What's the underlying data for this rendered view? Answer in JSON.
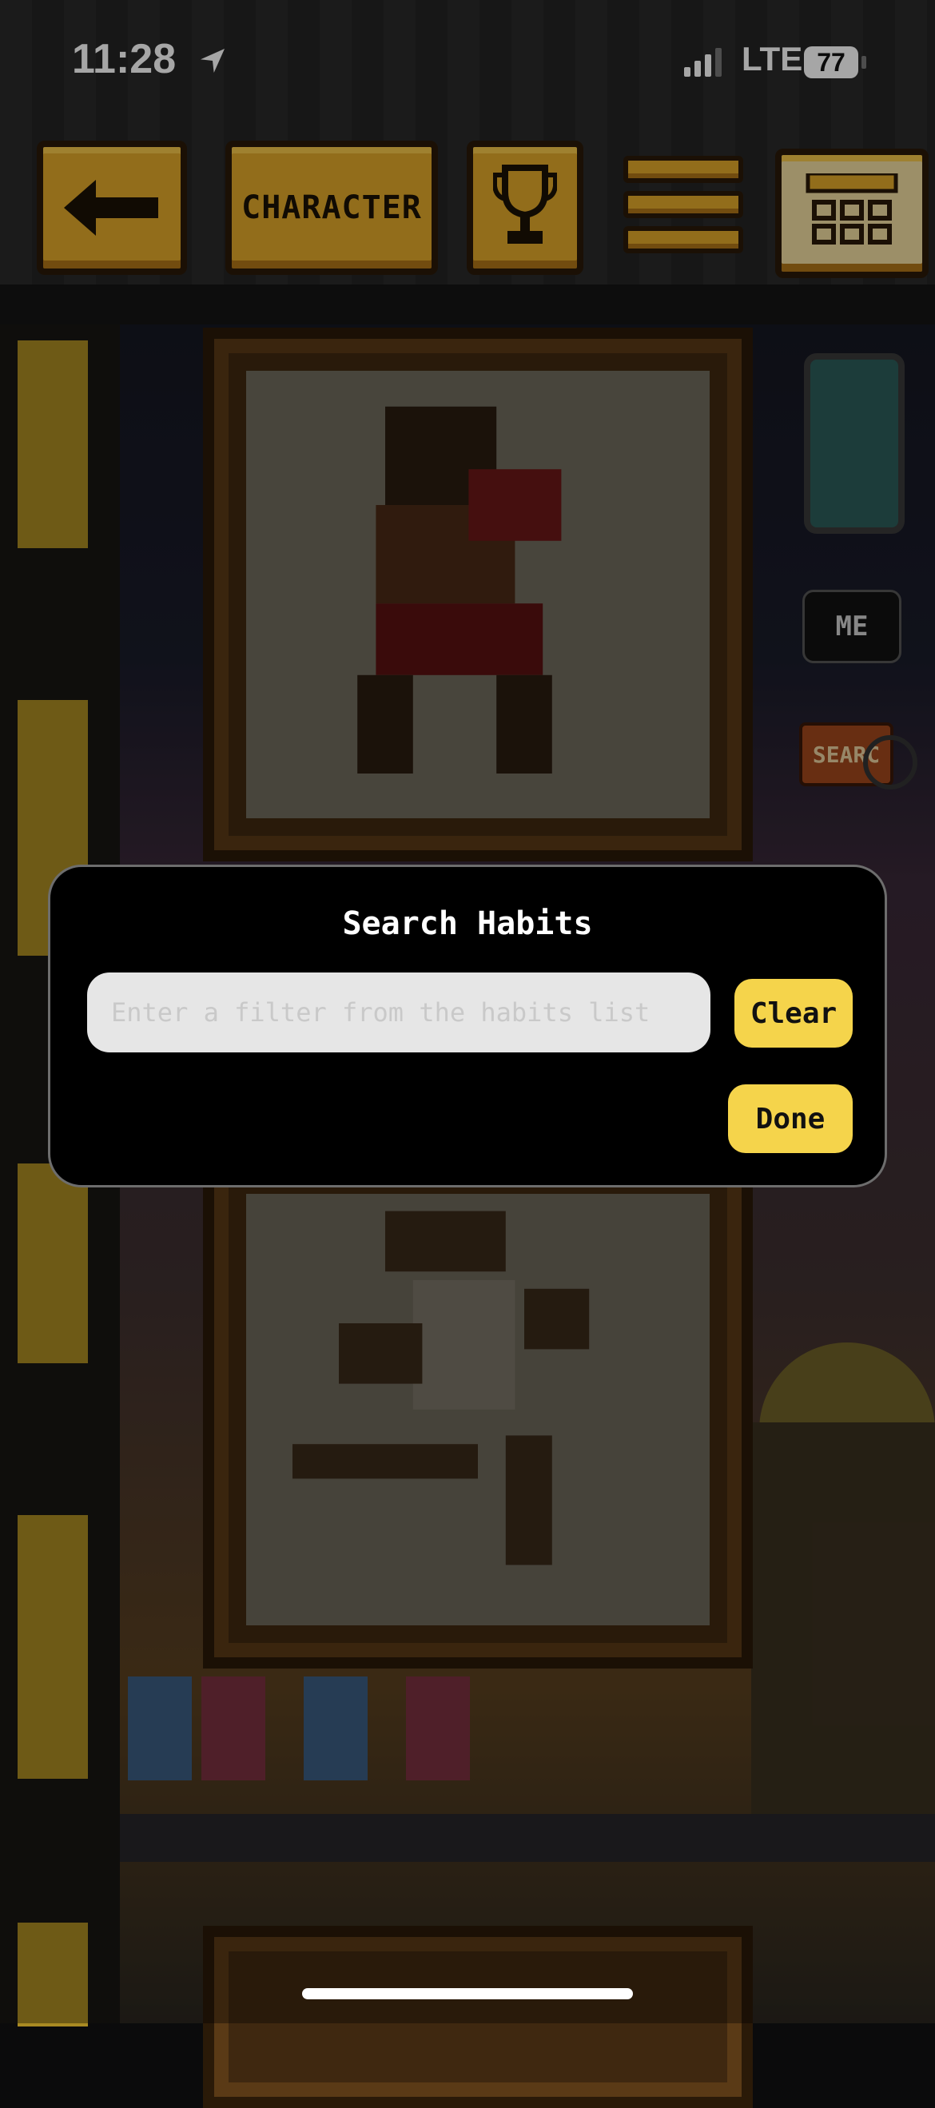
{
  "status_bar": {
    "time": "11:28",
    "network": "LTE",
    "battery": "77"
  },
  "toolbar": {
    "character_label": "CHARACTER",
    "back_icon": "arrow-left-icon",
    "trophy_icon": "trophy-icon",
    "menu_icon": "hamburger-menu-icon",
    "calendar_icon": "calendar-icon"
  },
  "side_panel": {
    "me_label": "ME",
    "search_label": "SEARC"
  },
  "search_dialog": {
    "title": "Search Habits",
    "input_value": "",
    "input_placeholder": "Enter a filter from the habits list",
    "clear_label": "Clear",
    "done_label": "Done"
  },
  "colors": {
    "accent_yellow": "#f5d44b",
    "toolbar_gold": "#e0a82a",
    "dialog_bg": "#000000"
  }
}
